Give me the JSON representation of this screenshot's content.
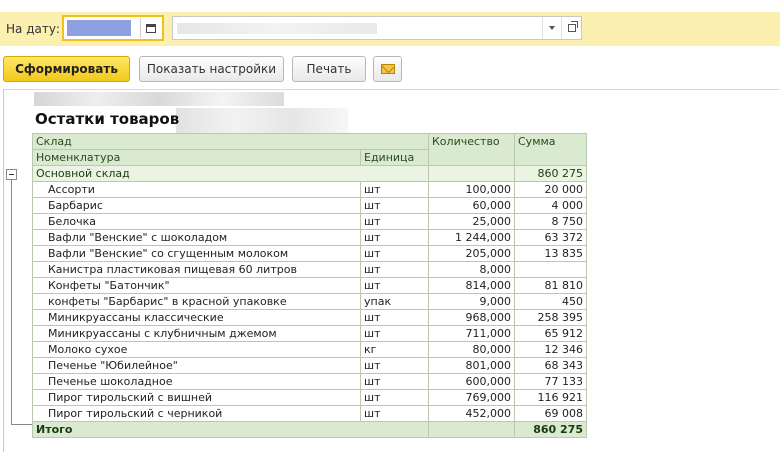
{
  "filter": {
    "date_label": "На дату:",
    "date_value": "",
    "org_value": ""
  },
  "toolbar": {
    "generate_label": "Сформировать",
    "settings_label": "Показать настройки",
    "print_label": "Печать"
  },
  "icons": {
    "calendar": "calendar-icon",
    "dropdown": "chevron-down-icon",
    "open": "open-icon",
    "mail": "envelope-icon",
    "tree_toggle": "collapse-icon"
  },
  "colors": {
    "primary_button": "#f3c818",
    "filter_bar": "#fbf0b0",
    "table_header": "#d9ead0"
  },
  "report": {
    "title": "Остатки товаров",
    "columns": {
      "warehouse": "Склад",
      "product": "Номенклатура",
      "unit": "Единица",
      "quantity": "Количество",
      "sum": "Сумма"
    },
    "group": {
      "name": "Основной склад",
      "quantity": "",
      "sum": "860 275"
    },
    "rows": [
      {
        "name": "Ассорти",
        "unit": "шт",
        "quantity": "100,000",
        "sum": "20 000"
      },
      {
        "name": "Барбарис",
        "unit": "шт",
        "quantity": "60,000",
        "sum": "4 000"
      },
      {
        "name": "Белочка",
        "unit": "шт",
        "quantity": "25,000",
        "sum": "8 750"
      },
      {
        "name": "Вафли \"Венские\" с шоколадом",
        "unit": "шт",
        "quantity": "1 244,000",
        "sum": "63 372"
      },
      {
        "name": "Вафли \"Венские\" со сгущенным молоком",
        "unit": "шт",
        "quantity": "205,000",
        "sum": "13 835"
      },
      {
        "name": "Канистра пластиковая пищевая 60 литров",
        "unit": "шт",
        "quantity": "8,000",
        "sum": ""
      },
      {
        "name": "Конфеты \"Батончик\"",
        "unit": "шт",
        "quantity": "814,000",
        "sum": "81 810"
      },
      {
        "name": "конфеты \"Барбарис\" в красной упаковке",
        "unit": "упак",
        "quantity": "9,000",
        "sum": "450"
      },
      {
        "name": "Миникруассаны классические",
        "unit": "шт",
        "quantity": "968,000",
        "sum": "258 395"
      },
      {
        "name": "Миникруассаны с клубничным джемом",
        "unit": "шт",
        "quantity": "711,000",
        "sum": "65 912"
      },
      {
        "name": "Молоко сухое",
        "unit": "кг",
        "quantity": "80,000",
        "sum": "12 346"
      },
      {
        "name": "Печенье \"Юбилейное\"",
        "unit": "шт",
        "quantity": "801,000",
        "sum": "68 343"
      },
      {
        "name": "Печенье шоколадное",
        "unit": "шт",
        "quantity": "600,000",
        "sum": "77 133"
      },
      {
        "name": "Пирог тирольский с вишней",
        "unit": "шт",
        "quantity": "769,000",
        "sum": "116 921"
      },
      {
        "name": "Пирог тирольский с черникой",
        "unit": "шт",
        "quantity": "452,000",
        "sum": "69 008"
      }
    ],
    "total": {
      "label": "Итого",
      "quantity": "",
      "sum": "860 275"
    }
  }
}
